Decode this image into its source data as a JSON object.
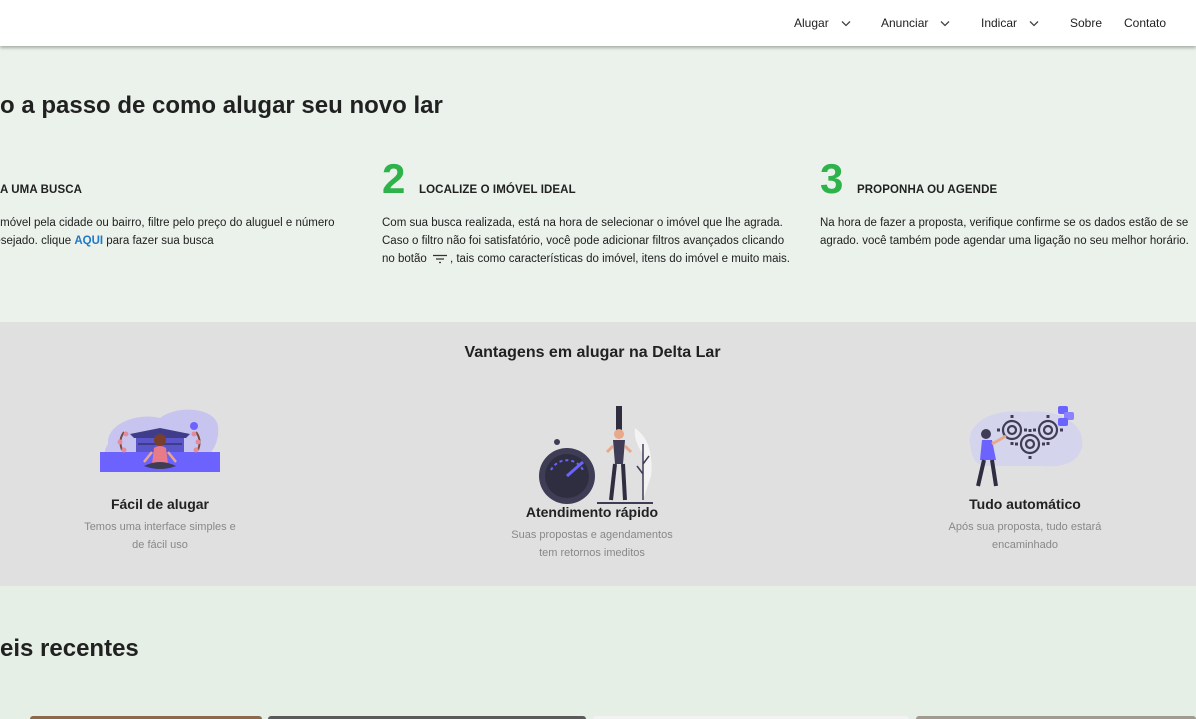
{
  "nav": {
    "items": [
      {
        "label": "Alugar"
      },
      {
        "label": "Anunciar"
      },
      {
        "label": "Indicar"
      },
      {
        "label": "Sobre"
      },
      {
        "label": "Contato"
      }
    ]
  },
  "steps": {
    "title": "o a passo de como alugar seu novo lar",
    "items": [
      {
        "label": "A UMA BUSCA",
        "desc_line1": "u imóvel pela cidade ou bairro, filtre pelo preço do aluguel e número",
        "desc_line2_pre": " desejado. clique ",
        "link": "AQUI",
        "desc_line2_post": " para fazer sua busca"
      },
      {
        "number": "2",
        "label": "LOCALIZE O IMÓVEL IDEAL",
        "desc_line1": "Com sua busca realizada, está na hora de selecionar o imóvel que lhe agrada.",
        "desc_line2": "Caso o filtro não foi satisfatório, você pode adicionar filtros avançados clicando",
        "desc_line3_pre": "no botão ",
        "desc_line3_post": ", tais como características do imóvel, itens do imóvel e muito mais."
      },
      {
        "number": "3",
        "label": "PROPONHA OU AGENDE",
        "desc_line1": "Na hora de fazer a proposta, verifique confirme se os dados estão de se",
        "desc_line2": "agrado. você também pode agendar uma ligação no seu melhor horário."
      }
    ]
  },
  "advantages": {
    "title": "Vantagens em alugar na Delta Lar",
    "cards": [
      {
        "title": "Fácil de alugar",
        "desc_line1": "Temos uma interface simples e",
        "desc_line2": "de fácil uso"
      },
      {
        "title": "Atendimento rápido",
        "desc_line1": "Suas propostas e agendamentos",
        "desc_line2": "tem retornos imeditos"
      },
      {
        "title": "Tudo automático",
        "desc_line1": "Após sua proposta, tudo estará",
        "desc_line2": "encaminhado"
      }
    ]
  },
  "recent": {
    "title": "eis recentes"
  },
  "colors": {
    "accent_green": "#2db34a",
    "link_blue": "#1f78c8",
    "illustration_purple": "#6c63ff"
  },
  "icons": [
    "chevron-down-icon",
    "filter-icon"
  ]
}
